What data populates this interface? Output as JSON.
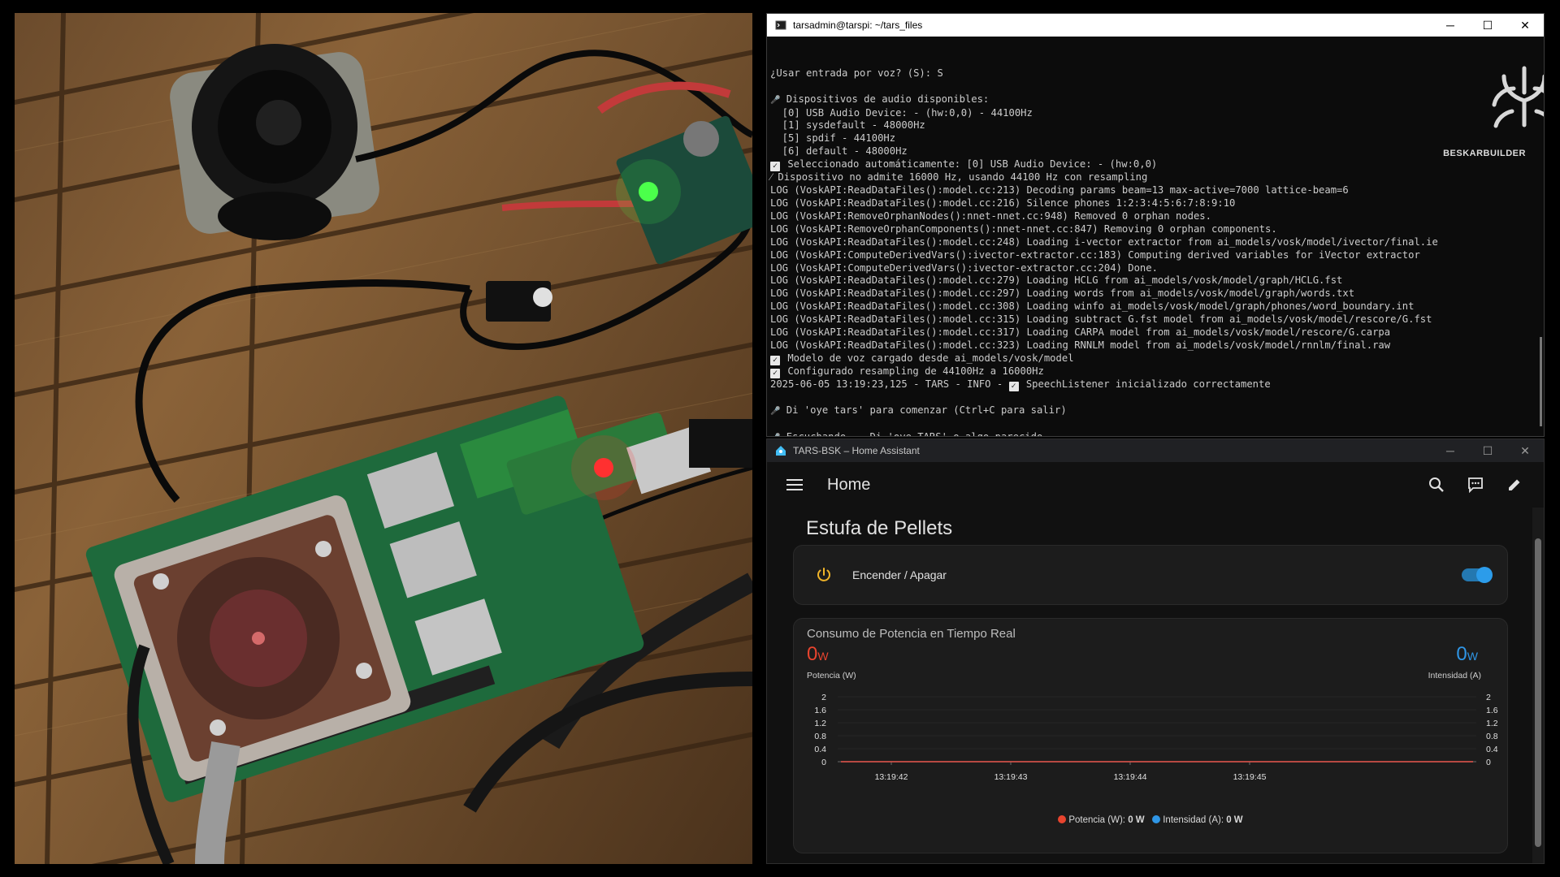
{
  "terminal": {
    "title": "tarsadmin@tarspi: ~/tars_files",
    "lines": [
      {
        "text": "¿Usar entrada por voz? (S): S"
      },
      {
        "text": ""
      },
      {
        "icon": "🎤",
        "text": " Dispositivos de audio disponibles:"
      },
      {
        "text": "  [0] USB Audio Device: - (hw:0,0) - 44100Hz"
      },
      {
        "text": "  [1] sysdefault - 48000Hz"
      },
      {
        "text": "  [5] spdif - 44100Hz"
      },
      {
        "text": "  [6] default - 48000Hz"
      },
      {
        "check": true,
        "text": " Seleccionado automáticamente: [0] USB Audio Device: - (hw:0,0)"
      },
      {
        "text": "⁄ Dispositivo no admite 16000 Hz, usando 44100 Hz con resampling"
      },
      {
        "text": "LOG (VoskAPI:ReadDataFiles():model.cc:213) Decoding params beam=13 max-active=7000 lattice-beam=6"
      },
      {
        "text": "LOG (VoskAPI:ReadDataFiles():model.cc:216) Silence phones 1:2:3:4:5:6:7:8:9:10"
      },
      {
        "text": "LOG (VoskAPI:RemoveOrphanNodes():nnet-nnet.cc:948) Removed 0 orphan nodes."
      },
      {
        "text": "LOG (VoskAPI:RemoveOrphanComponents():nnet-nnet.cc:847) Removing 0 orphan components."
      },
      {
        "text": "LOG (VoskAPI:ReadDataFiles():model.cc:248) Loading i-vector extractor from ai_models/vosk/model/ivector/final.ie"
      },
      {
        "text": "LOG (VoskAPI:ComputeDerivedVars():ivector-extractor.cc:183) Computing derived variables for iVector extractor"
      },
      {
        "text": "LOG (VoskAPI:ComputeDerivedVars():ivector-extractor.cc:204) Done."
      },
      {
        "text": "LOG (VoskAPI:ReadDataFiles():model.cc:279) Loading HCLG from ai_models/vosk/model/graph/HCLG.fst"
      },
      {
        "text": "LOG (VoskAPI:ReadDataFiles():model.cc:297) Loading words from ai_models/vosk/model/graph/words.txt"
      },
      {
        "text": "LOG (VoskAPI:ReadDataFiles():model.cc:308) Loading winfo ai_models/vosk/model/graph/phones/word_boundary.int"
      },
      {
        "text": "LOG (VoskAPI:ReadDataFiles():model.cc:315) Loading subtract G.fst model from ai_models/vosk/model/rescore/G.fst"
      },
      {
        "text": "LOG (VoskAPI:ReadDataFiles():model.cc:317) Loading CARPA model from ai_models/vosk/model/rescore/G.carpa"
      },
      {
        "text": "LOG (VoskAPI:ReadDataFiles():model.cc:323) Loading RNNLM model from ai_models/vosk/model/rnnlm/final.raw"
      },
      {
        "check": true,
        "text": " Modelo de voz cargado desde ai_models/vosk/model"
      },
      {
        "check": true,
        "text": " Configurado resampling de 44100Hz a 16000Hz"
      },
      {
        "text": "2025-06-05 13:19:23,125 - TARS - INFO - ",
        "check_after": true,
        "text_after": " SpeechListener inicializado correctamente"
      },
      {
        "text": ""
      },
      {
        "icon": "🎤",
        "text": " Di 'oye tars' para comenzar (Ctrl+C para salir)"
      },
      {
        "text": ""
      },
      {
        "icon": "🎤",
        "text": " Escuchando... Di 'oye TARS' o algo parecido"
      }
    ],
    "logo_text": "BESKARBUILDER"
  },
  "homeassistant": {
    "window_title": "TARS-BSK – Home Assistant",
    "header_title": "Home",
    "section_title": "Estufa de Pellets",
    "switch_label": "Encender / Apagar",
    "switch_on": true,
    "chart_card_title": "Consumo de Potencia en Tiempo Real",
    "power_value": "0",
    "power_unit": "W",
    "power_label": "Potencia (W)",
    "current_value": "0",
    "current_unit": "W",
    "current_label": "Intensidad (A)",
    "legend_power": "Potencia (W): ",
    "legend_power_val": "0 W",
    "legend_current": "Intensidad (A): ",
    "legend_current_val": "0 W",
    "colors": {
      "power": "#e8442e",
      "current": "#2f96e6",
      "accent": "#2c9cea"
    }
  },
  "chart_data": {
    "type": "line",
    "x": [
      "13:19:42",
      "13:19:43",
      "13:19:44",
      "13:19:45"
    ],
    "series": [
      {
        "name": "Potencia (W)",
        "values": [
          0,
          0,
          0,
          0
        ]
      },
      {
        "name": "Intensidad (A)",
        "values": [
          0,
          0,
          0,
          0
        ]
      }
    ],
    "ylim": [
      0,
      2
    ],
    "yticks": [
      "2",
      "1.6",
      "1.2",
      "0.8",
      "0.4",
      "0"
    ],
    "y2ticks": [
      "2",
      "1.6",
      "1.2",
      "0.8",
      "0.4",
      "0"
    ],
    "grid": true,
    "legend_position": "bottom"
  }
}
